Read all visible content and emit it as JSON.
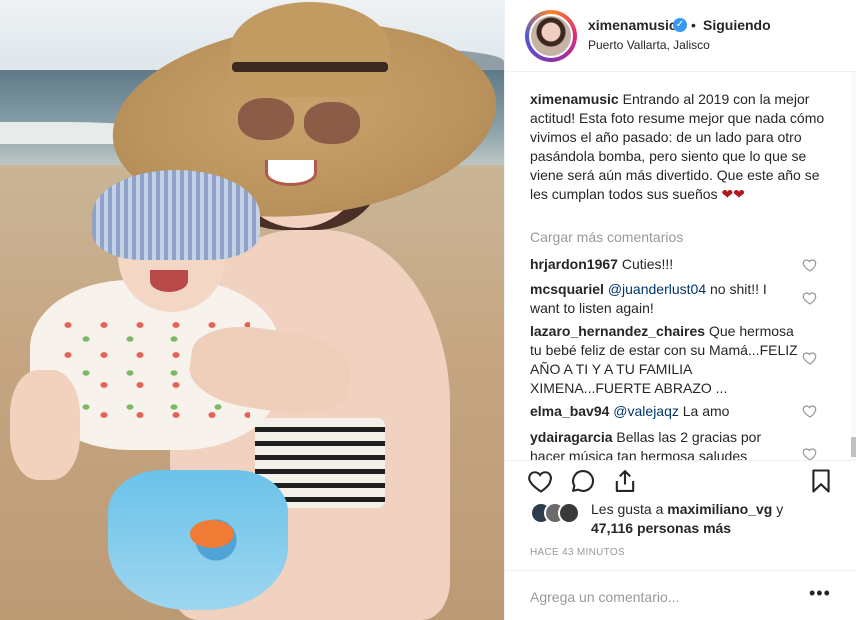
{
  "post": {
    "username": "ximenamusic",
    "verified_icon": "verified-badge-icon",
    "separator": "•",
    "follow_status": "Siguiendo",
    "location": "Puerto Vallarta, Jalisco"
  },
  "caption": {
    "username": "ximenamusic",
    "text": "Entrando al 2019 con la mejor actitud! Esta foto resume mejor que nada cómo vivimos el año pasado: de un lado para otro pasándola bomba, pero siento que lo que se viene será aún más divertido. Que este año se les cumplan todos sus sueños",
    "emoji": "❤❤"
  },
  "load_more": "Cargar más comentarios",
  "comments": [
    {
      "user": "hrjardon1967",
      "text": "Cuties!!!"
    },
    {
      "user": "mcsquariel",
      "mention": "@juanderlust04",
      "text": "no shit!! I want to listen again!"
    },
    {
      "user": "lazaro_hernandez_chaires",
      "text": "Que hermosa tu bebé feliz de estar con su Mamá...FELIZ AÑO A TI Y A TU FAMILIA XIMENA...FUERTE ABRAZO ..."
    },
    {
      "user": "elma_bav94",
      "mention": "@valejaqz",
      "text": "La amo"
    },
    {
      "user": "ydairagarcia",
      "text": "Bellas las 2 gracias por hacer música tan hermosa saludes"
    }
  ],
  "likes": {
    "prefix": "Les gusta a",
    "user": "maximiliano_vg",
    "conj": "y",
    "count": "47,116 personas más"
  },
  "timestamp": "Hace 43 minutos",
  "add_comment": {
    "placeholder": "Agrega un comentario...",
    "more": "•••"
  },
  "colors": {
    "text": "#262626",
    "muted": "#999999",
    "mention": "#003569",
    "verified": "#3897f0",
    "heart": "#b3181e"
  }
}
